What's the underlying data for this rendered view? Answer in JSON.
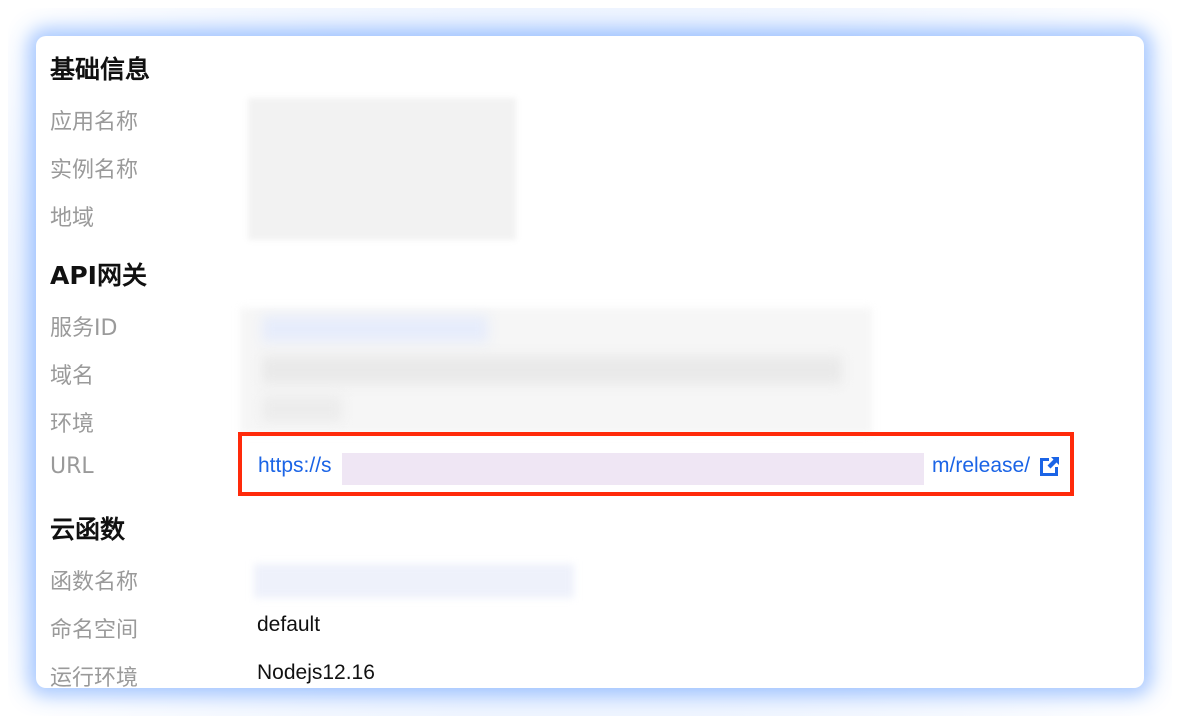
{
  "sections": {
    "basic": "基础信息",
    "api": "API网关",
    "scf": "云函数"
  },
  "labels": {
    "app_name": "应用名称",
    "instance_name": "实例名称",
    "region": "地域",
    "service_id": "服务ID",
    "domain": "域名",
    "env": "环境",
    "url": "URL",
    "function_name": "函数名称",
    "namespace": "命名空间",
    "runtime": "运行环境"
  },
  "values": {
    "url_start": "https://s",
    "url_end": "m/release/",
    "namespace": "default",
    "runtime": "Nodejs12.16"
  },
  "icons": {
    "external_link": "external-link-icon"
  },
  "colors": {
    "link": "#1b64e6",
    "highlight_border": "#ff2a0a",
    "glow": "#468cff"
  }
}
